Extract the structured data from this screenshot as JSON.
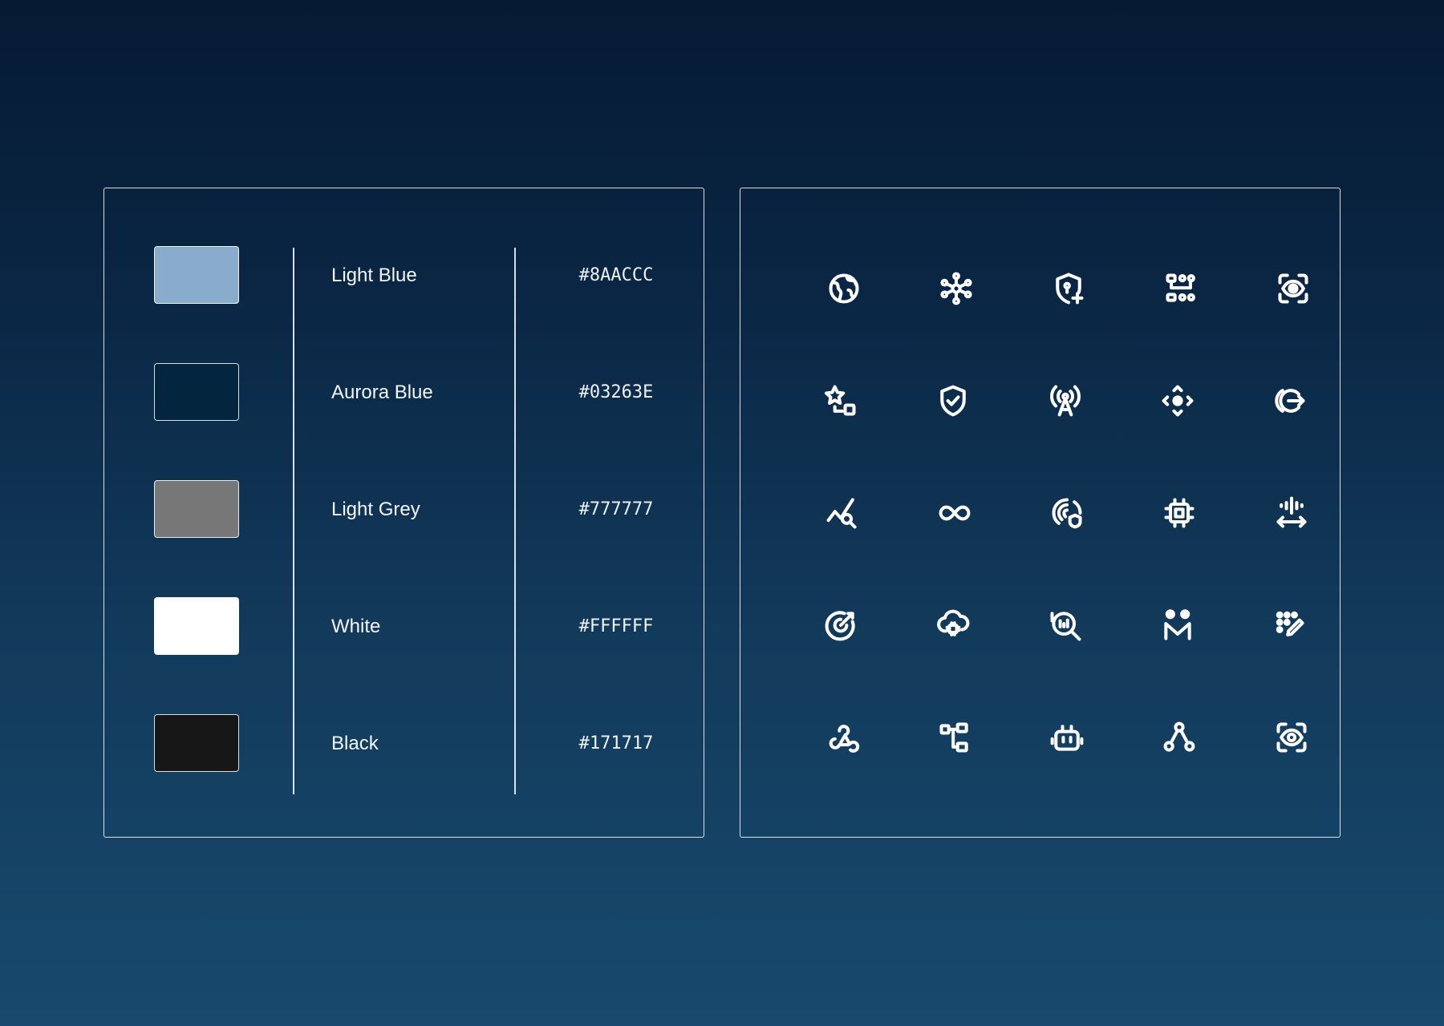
{
  "palette": {
    "colors": [
      {
        "name": "Light Blue",
        "hex": "#8AACCC",
        "fill": "#8AACCC"
      },
      {
        "name": "Aurora Blue",
        "hex": "#03263E",
        "fill": "#03263E"
      },
      {
        "name": "Light Grey",
        "hex": "#777777",
        "fill": "#777777"
      },
      {
        "name": "White",
        "hex": "#FFFFFF",
        "fill": "#FFFFFF"
      },
      {
        "name": "Black",
        "hex": "#171717",
        "fill": "#171717"
      }
    ]
  },
  "icons": [
    [
      "globe-icon",
      "network-hub-icon",
      "shield-lock-add-icon",
      "org-chart-icon",
      "focus-view-icon"
    ],
    [
      "favorites-shapes-icon",
      "shield-check-icon",
      "broadcast-tower-icon",
      "directional-pad-icon",
      "logout-arrow-icon"
    ],
    [
      "analytics-search-icon",
      "infinity-icon",
      "fingerprint-shield-icon",
      "cpu-chip-icon",
      "resize-horizontal-icon"
    ],
    [
      "target-icon",
      "cloud-chip-icon",
      "data-search-icon",
      "people-connect-icon",
      "dots-edit-icon"
    ],
    [
      "webhook-icon",
      "hierarchy-icon",
      "robot-icon",
      "share-nodes-icon",
      "eye-scan-icon"
    ]
  ]
}
